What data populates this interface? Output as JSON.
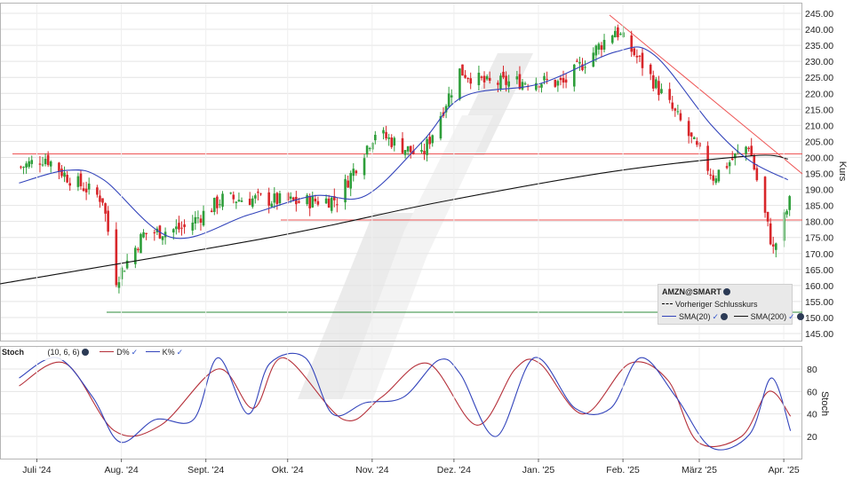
{
  "app": {
    "watermark": "guidants-logo"
  },
  "price_panel": {
    "y_axis_title": "Kurs",
    "y_ticks": [
      "145.00",
      "150.00",
      "155.00",
      "160.00",
      "165.00",
      "170.00",
      "175.00",
      "180.00",
      "185.00",
      "190.00",
      "195.00",
      "200.00",
      "205.00",
      "210.00",
      "215.00",
      "220.00",
      "225.00",
      "230.00",
      "235.00",
      "240.00",
      "245.00"
    ],
    "legend": {
      "symbol": "AMZN@SMART",
      "prev_close_label": "Vorheriger Schlusskurs",
      "sma20_label": "SMA(20)",
      "sma200_label": "SMA(200)"
    }
  },
  "stoch_panel": {
    "title": "Stoch",
    "params": "(10, 6, 6)",
    "d_label": "D%",
    "k_label": "K%",
    "y_axis_title": "Stoch",
    "y_ticks": [
      "20",
      "40",
      "60",
      "80"
    ]
  },
  "x_axis": {
    "labels": [
      "Juli '24",
      "Aug. '24",
      "Sept. '24",
      "Okt. '24",
      "Nov. '24",
      "Dez. '24",
      "Jan. '25",
      "Feb. '25",
      "März '25",
      "Apr. '25"
    ]
  },
  "colors": {
    "up": "#2e9e3a",
    "down": "#d8262a",
    "sma20": "#3344bb",
    "sma200": "#111111",
    "resistance": "#ee5555",
    "support": "#2e8b3a",
    "stoch_k": "#3344bb",
    "stoch_d": "#b5303a"
  },
  "chart_data": [
    {
      "type": "candlestick",
      "symbol": "AMZN@SMART",
      "ylabel": "Kurs",
      "ylim": [
        142,
        248
      ],
      "x_range": [
        "2024-06-24",
        "2025-04-14"
      ],
      "series": [
        {
          "name": "Kurs",
          "x": [
            "2024-07-01",
            "2024-07-10",
            "2024-07-18",
            "2024-07-31",
            "2024-08-05",
            "2024-08-15",
            "2024-08-30",
            "2024-09-13",
            "2024-09-27",
            "2024-10-10",
            "2024-10-25",
            "2024-11-08",
            "2024-11-25",
            "2024-12-09",
            "2024-12-19",
            "2025-01-06",
            "2025-01-16",
            "2025-02-04",
            "2025-02-14",
            "2025-02-28",
            "2025-03-12",
            "2025-03-25",
            "2025-04-03",
            "2025-04-09"
          ],
          "values": [
            197,
            200,
            194,
            187,
            162,
            176,
            178,
            187,
            187,
            186,
            187,
            208,
            200,
            227,
            223,
            224,
            223,
            240,
            229,
            211,
            194,
            204,
            171,
            186
          ]
        }
      ]
    },
    {
      "type": "line",
      "series": [
        {
          "name": "SMA(20)",
          "x": [
            "2024-07-01",
            "2024-07-19",
            "2024-08-01",
            "2024-08-26",
            "2024-09-23",
            "2024-10-17",
            "2024-11-05",
            "2024-11-26",
            "2024-12-11",
            "2025-01-08",
            "2025-02-05",
            "2025-02-19",
            "2025-03-12",
            "2025-03-26",
            "2025-04-09"
          ],
          "values": [
            192,
            196,
            193,
            175,
            182,
            188,
            188,
            205,
            219,
            223,
            233,
            232,
            210,
            199,
            193
          ]
        },
        {
          "name": "SMA(200)",
          "x": [
            "2024-06-24",
            "2024-10-01",
            "2024-12-02",
            "2025-02-03",
            "2025-03-27",
            "2025-04-09"
          ],
          "values": [
            160.5,
            175,
            186,
            195.5,
            200.5,
            199.5
          ]
        }
      ]
    },
    {
      "type": "line",
      "title": "Stoch (10, 6, 6)",
      "ylabel": "Stoch",
      "ylim": [
        0,
        100
      ],
      "series": [
        {
          "name": "K%",
          "x": [
            "2024-07-01",
            "2024-07-15",
            "2024-07-28",
            "2024-08-07",
            "2024-08-20",
            "2024-09-03",
            "2024-09-12",
            "2024-09-23",
            "2024-10-01",
            "2024-10-14",
            "2024-10-24",
            "2024-11-05",
            "2024-11-19",
            "2024-12-02",
            "2024-12-10",
            "2024-12-23",
            "2025-01-06",
            "2025-01-21",
            "2025-02-03",
            "2025-02-14",
            "2025-02-27",
            "2025-03-12",
            "2025-03-26",
            "2025-04-03",
            "2025-04-10"
          ],
          "values": [
            72,
            90,
            55,
            15,
            35,
            35,
            90,
            40,
            85,
            90,
            40,
            50,
            55,
            88,
            75,
            20,
            90,
            45,
            45,
            90,
            55,
            10,
            22,
            72,
            25
          ]
        },
        {
          "name": "D%",
          "x": [
            "2024-07-01",
            "2024-07-18",
            "2024-08-05",
            "2024-08-22",
            "2024-09-12",
            "2024-09-25",
            "2024-10-06",
            "2024-10-28",
            "2024-11-11",
            "2024-11-28",
            "2024-12-16",
            "2024-12-30",
            "2025-01-08",
            "2025-01-24",
            "2025-02-10",
            "2025-02-24",
            "2025-03-07",
            "2025-03-23",
            "2025-04-02",
            "2025-04-10"
          ],
          "values": [
            65,
            85,
            25,
            30,
            80,
            45,
            90,
            35,
            55,
            85,
            30,
            80,
            85,
            40,
            85,
            70,
            15,
            20,
            60,
            38
          ]
        }
      ]
    }
  ]
}
